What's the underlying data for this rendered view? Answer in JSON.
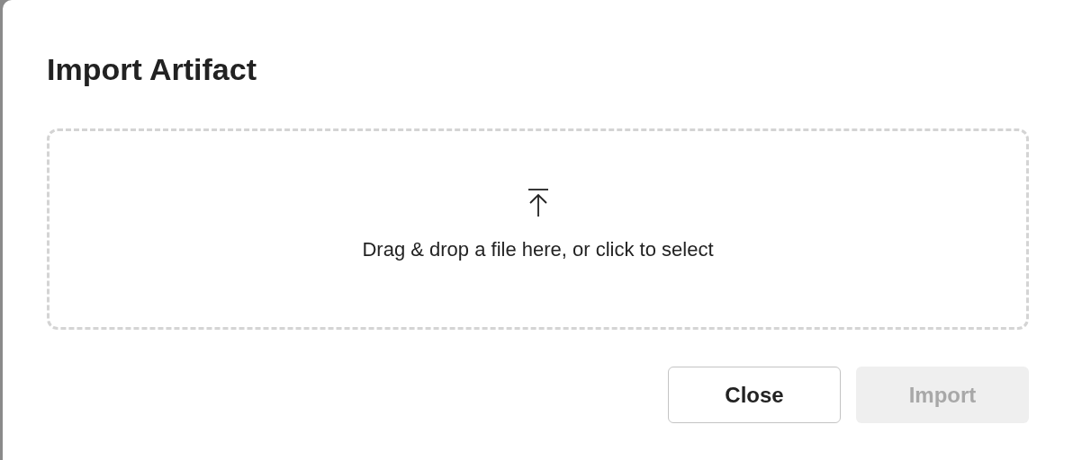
{
  "dialog": {
    "title": "Import Artifact"
  },
  "dropzone": {
    "text": "Drag & drop a file here, or click to select"
  },
  "buttons": [
    {
      "label": "Close",
      "disabled": false
    },
    {
      "label": "Import",
      "disabled": true
    }
  ]
}
